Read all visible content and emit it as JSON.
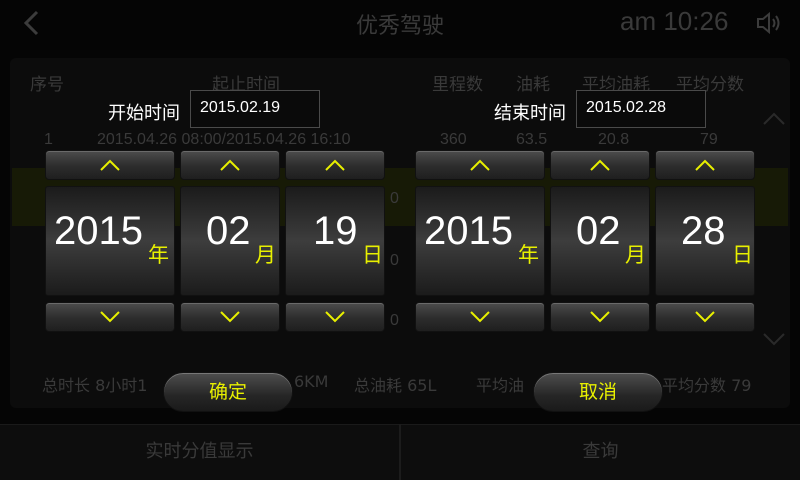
{
  "app": {
    "title": "优秀驾驶",
    "clock": "am 10:26",
    "icons": {
      "back": "back-chevron-icon",
      "volume": "speaker-icon",
      "scroll_up": "chevron-up-icon",
      "scroll_down": "chevron-down-icon"
    }
  },
  "table": {
    "headers": [
      "序号",
      "起止时间",
      "里程数",
      "油耗",
      "平均油耗",
      "平均分数"
    ],
    "first_row": {
      "index": "1",
      "time": "2015.04.26  08:00/2015.04.26  16:10",
      "mileage": "360",
      "fuel": "63.5",
      "avg_fuel": "20.8",
      "avg_score": "79"
    },
    "partial_cells": [
      "0",
      "0",
      "0"
    ]
  },
  "summary": {
    "duration": "总时长  8小时1",
    "distance": "6KM",
    "fuel": "总油耗  65L",
    "avg_fuel": "平均油",
    "avg_score": "平均分数  79"
  },
  "bottom_bar": {
    "realtime_label": "实时分值显示",
    "query_label": "查询"
  },
  "picker": {
    "start": {
      "label": "开始时间",
      "value": "2015.02.19",
      "year": "2015",
      "month": "02",
      "day": "19"
    },
    "end": {
      "label": "结束时间",
      "value": "2015.02.28",
      "year": "2015",
      "month": "02",
      "day": "28"
    },
    "units": {
      "year": "年",
      "month": "月",
      "day": "日"
    },
    "confirm_label": "确定",
    "cancel_label": "取消"
  },
  "colors": {
    "accent": "#e8f000",
    "background": "#000000",
    "dim_text": "#3a3a3a"
  }
}
